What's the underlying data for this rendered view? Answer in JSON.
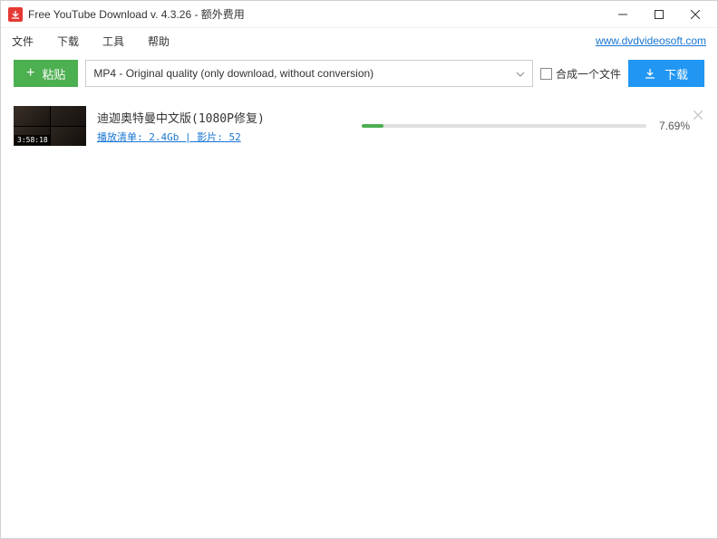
{
  "titlebar": {
    "title": "Free YouTube Download v. 4.3.26 - 额外费用"
  },
  "menu": {
    "file": "文件",
    "download": "下载",
    "tools": "工具",
    "help": "帮助",
    "website": "www.dvdvideosoft.com"
  },
  "toolbar": {
    "paste_label": "粘贴",
    "format": "MP4 - Original quality (only download, without conversion)",
    "merge_label": "合成一个文件",
    "download_label": "下载"
  },
  "item": {
    "title": "迪迦奥特曼中文版(1080P修复)",
    "meta": "播放清单: 2.4Gb  |  影片: 52",
    "duration": "3:58:18",
    "progress_percent": 7.69,
    "progress_text": "7.69%"
  }
}
